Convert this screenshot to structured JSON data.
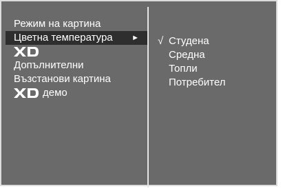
{
  "left_menu": {
    "items": [
      {
        "label": "Режим на картина"
      },
      {
        "label": "Цветна температура",
        "arrow": "►"
      },
      {
        "label": "",
        "icon": "xd-logo-icon"
      },
      {
        "label": "Допълнителни"
      },
      {
        "label": "Възстанови картина"
      },
      {
        "label": "демо",
        "icon": "xd-logo-icon"
      }
    ]
  },
  "right_menu": {
    "check_mark": "√",
    "items": [
      {
        "label": "Студена"
      },
      {
        "label": "Средна"
      },
      {
        "label": "Топли"
      },
      {
        "label": "Потребител"
      }
    ]
  },
  "colors": {
    "panel_bg": "#6a6a6a",
    "selected_bg": "#2e2e2e",
    "text": "#ffffff"
  }
}
